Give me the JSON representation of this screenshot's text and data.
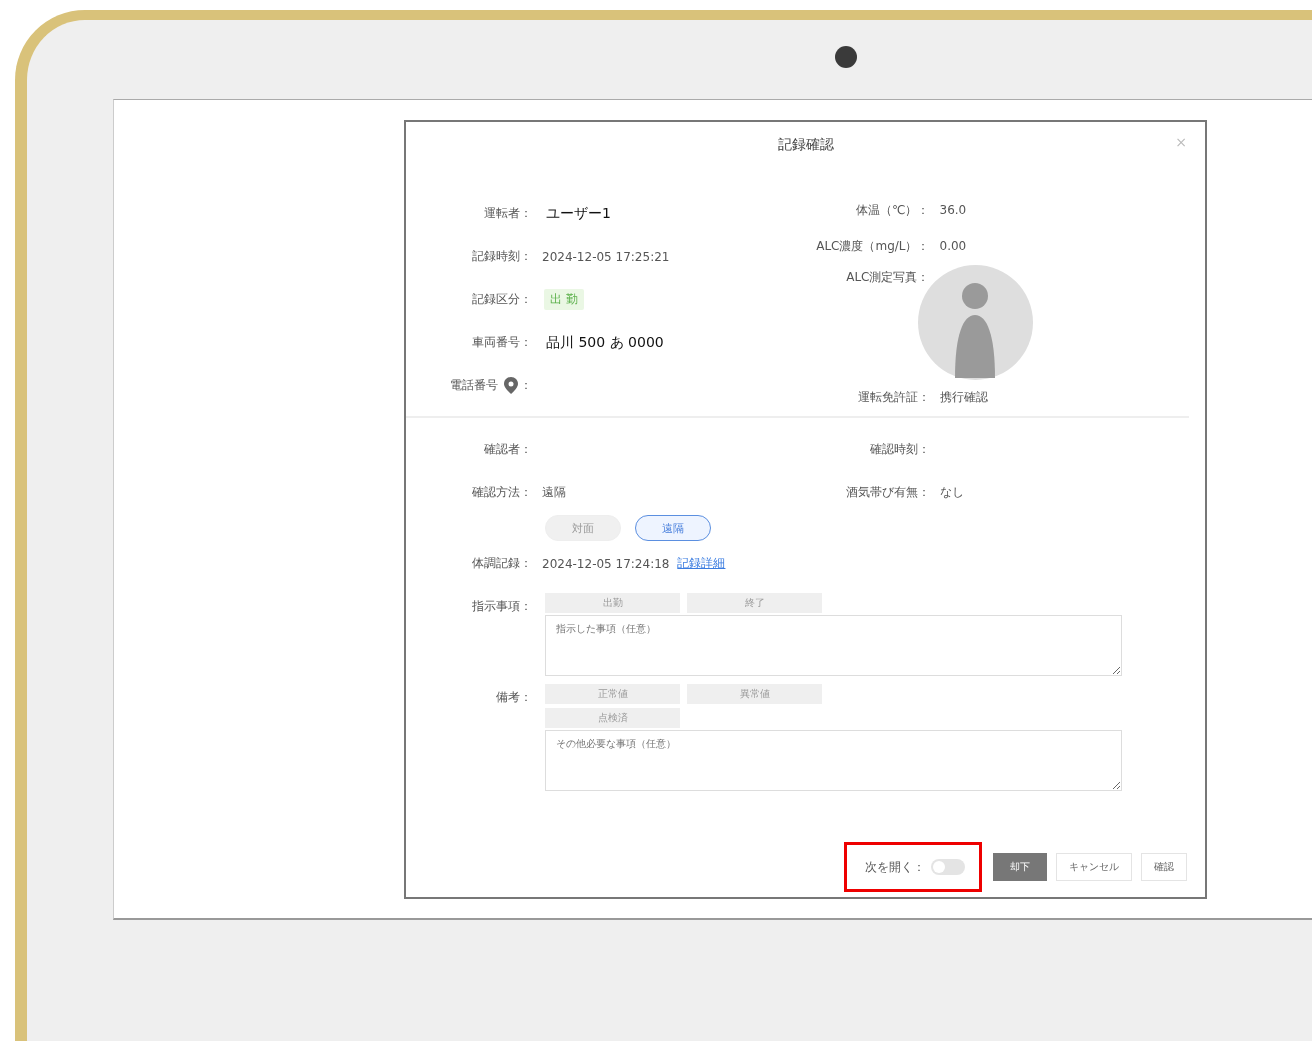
{
  "dialog": {
    "title": "記録確認",
    "close": "×",
    "left_fields": [
      {
        "kind": "large",
        "label": "運転者：",
        "value": "ユーザー1"
      },
      {
        "kind": "text",
        "label": "記録時刻：",
        "value": "2024-12-05 17:25:21"
      },
      {
        "kind": "tag",
        "label": "記録区分：",
        "value": "出 勤"
      },
      {
        "kind": "large",
        "label": "車両番号：",
        "value": "品川 500 あ 0000"
      },
      {
        "kind": "pin",
        "label": "電話番号",
        "suffix": "："
      }
    ],
    "right_fields": [
      {
        "kind": "text",
        "label": "体温（℃）：",
        "value": "36.0"
      },
      {
        "kind": "text",
        "label": "ALC濃度（mg/L）：",
        "value": "0.00"
      },
      {
        "kind": "photo",
        "label": "ALC測定写真："
      },
      {
        "kind": "text",
        "label": "運転免許証：",
        "value": "携行確認"
      }
    ],
    "confirmer": {
      "label": "確認者："
    },
    "confirm_time": {
      "label": "確認時刻："
    },
    "method": {
      "label": "確認方法：",
      "value": "遠隔",
      "options": [
        {
          "label": "対面",
          "selected": false
        },
        {
          "label": "遠隔",
          "selected": true
        }
      ]
    },
    "alcohol": {
      "label": "酒気帯び有無：",
      "value": "なし"
    },
    "health": {
      "label": "体調記録：",
      "value": "2024-12-05 17:24:18",
      "link": "記録詳細"
    },
    "instructions": {
      "label": "指示事項：",
      "chips": [
        "出勤",
        "終了"
      ],
      "placeholder": "指示した事項（任意）"
    },
    "remarks": {
      "label": "備考：",
      "chips": [
        "正常値",
        "異常値",
        "点検済"
      ],
      "placeholder": "その他必要な事項（任意）"
    },
    "footer": {
      "toggle_label": "次を開く：",
      "toggle_on": false,
      "buttons": [
        {
          "label": "却下",
          "kind": "dark"
        },
        {
          "label": "キャンセル",
          "kind": "plain"
        },
        {
          "label": "確認",
          "kind": "plain"
        }
      ]
    }
  }
}
